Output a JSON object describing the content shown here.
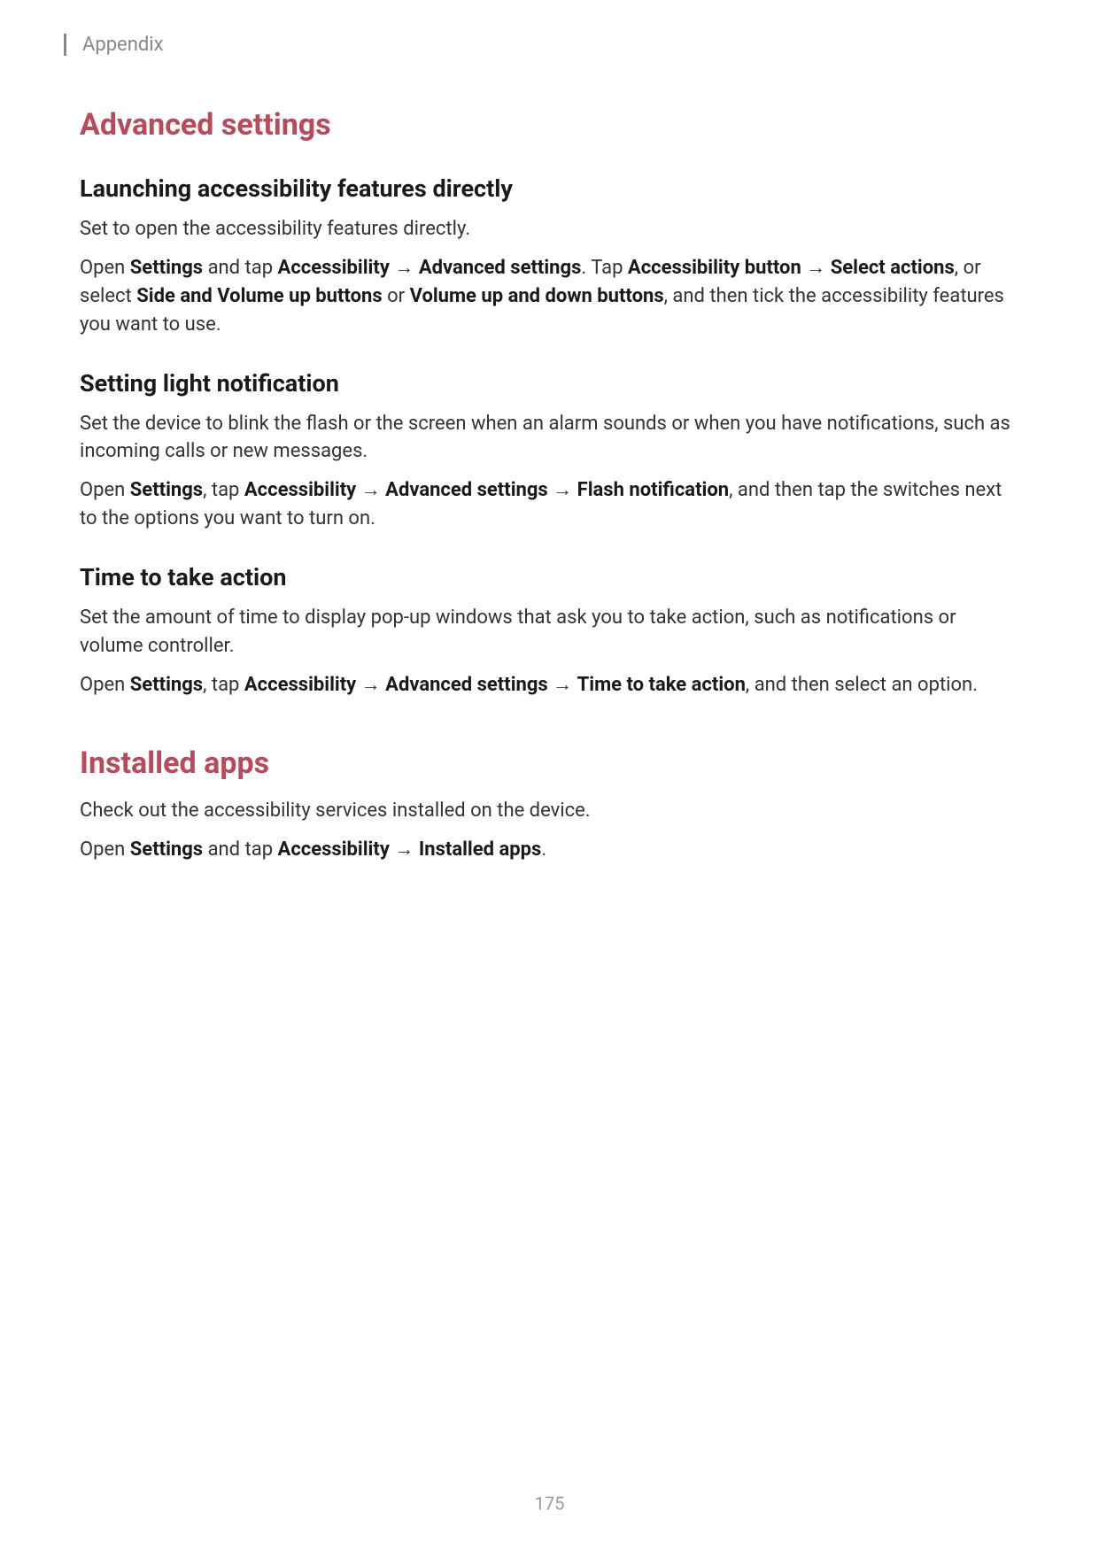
{
  "header": {
    "breadcrumb": "Appendix"
  },
  "section1": {
    "title": "Advanced settings",
    "sub1": {
      "title": "Launching accessibility features directly",
      "p1": "Set to open the accessibility features directly.",
      "p2_parts": {
        "t1": "Open ",
        "b1": "Settings",
        "t2": " and tap ",
        "b2": "Accessibility",
        "t3": " → ",
        "b3": "Advanced settings",
        "t4": ". Tap ",
        "b4": "Accessibility button",
        "t5": " → ",
        "b5": "Select actions",
        "t6": ", or select ",
        "b6": "Side and Volume up buttons",
        "t7": " or ",
        "b7": "Volume up and down buttons",
        "t8": ", and then tick the accessibility features you want to use."
      }
    },
    "sub2": {
      "title": "Setting light notification",
      "p1": "Set the device to blink the flash or the screen when an alarm sounds or when you have notifications, such as incoming calls or new messages.",
      "p2_parts": {
        "t1": "Open ",
        "b1": "Settings",
        "t2": ", tap ",
        "b2": "Accessibility",
        "t3": " → ",
        "b3": "Advanced settings",
        "t4": " → ",
        "b4": "Flash notification",
        "t5": ", and then tap the switches next to the options you want to turn on."
      }
    },
    "sub3": {
      "title": "Time to take action",
      "p1": "Set the amount of time to display pop-up windows that ask you to take action, such as notifications or volume controller.",
      "p2_parts": {
        "t1": "Open ",
        "b1": "Settings",
        "t2": ", tap ",
        "b2": "Accessibility",
        "t3": " → ",
        "b3": "Advanced settings",
        "t4": " → ",
        "b4": "Time to take action",
        "t5": ", and then select an option."
      }
    }
  },
  "section2": {
    "title": "Installed apps",
    "p1": "Check out the accessibility services installed on the device.",
    "p2_parts": {
      "t1": "Open ",
      "b1": "Settings",
      "t2": " and tap ",
      "b2": "Accessibility",
      "t3": " → ",
      "b3": "Installed apps",
      "t4": "."
    }
  },
  "footer": {
    "page_number": "175"
  }
}
